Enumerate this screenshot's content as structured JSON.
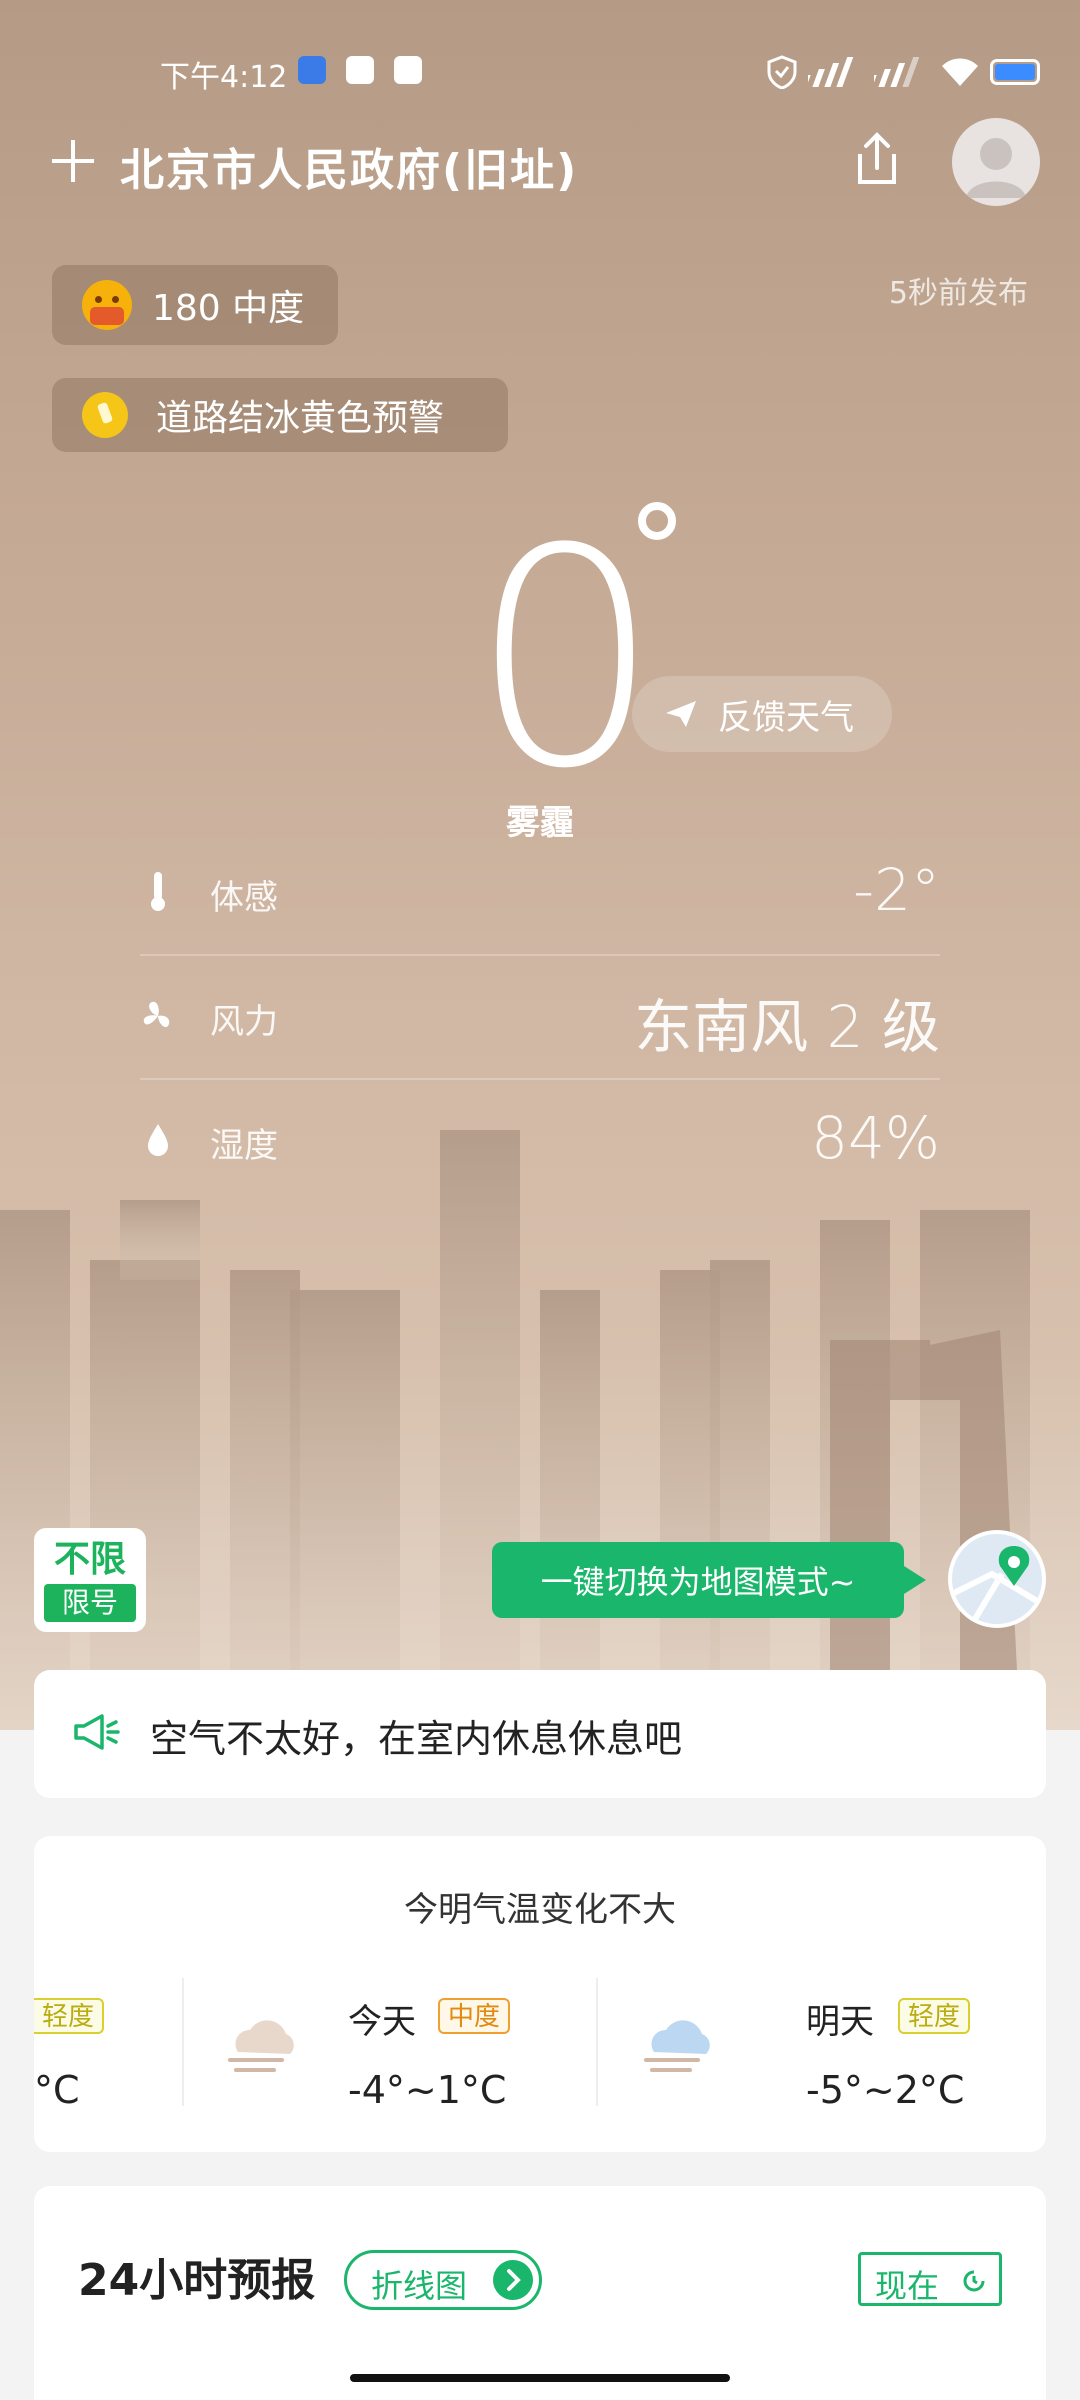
{
  "status_bar": {
    "time": "下午4:12",
    "icons": [
      "app-icon-blue",
      "app-icon-cat",
      "app-icon-clipboard"
    ],
    "right_icons": [
      "vpn-shield-icon",
      "hd-signal-icon",
      "hd-signal-icon",
      "wifi-icon",
      "battery-icon"
    ],
    "battery_color": "#3b8cff"
  },
  "header": {
    "location": "北京市人民政府(旧址)",
    "add_icon": "plus-icon",
    "share_icon": "share-icon",
    "avatar_icon": "avatar-icon"
  },
  "air_quality": {
    "value": "180 中度",
    "icon": "mask-face-icon",
    "color": "#f6b20a"
  },
  "published": "5秒前发布",
  "warning": {
    "text": "道路结冰黄色预警",
    "icon": "ice-warning-icon",
    "color": "#f5c518"
  },
  "current": {
    "temperature": "0",
    "condition": "雾霾",
    "feedback_label": "反馈天气"
  },
  "details": [
    {
      "label": "体感",
      "value": "-2°",
      "icon": "thermometer-icon"
    },
    {
      "label": "风力",
      "value": "东南风 2 级",
      "icon": "fan-icon"
    },
    {
      "label": "湿度",
      "value": "84%",
      "icon": "droplet-icon"
    }
  ],
  "traffic_limit": {
    "line1": "不限",
    "line2": "限号"
  },
  "map_mode_label": "一键切换为地图模式~",
  "tip": {
    "text": "空气不太好，在室内休息休息吧",
    "icon": "megaphone-icon"
  },
  "forecast": {
    "title": "今明气温变化不大",
    "partial": {
      "tag": "轻度",
      "range_tail": "°C"
    },
    "days": [
      {
        "name": "今天",
        "tag": "中度",
        "range": "-4°~1°C",
        "icon": "haze-cloud-icon"
      },
      {
        "name": "明天",
        "tag": "轻度",
        "range": "-5°~2°C",
        "icon": "cloud-haze-icon"
      }
    ]
  },
  "hourly": {
    "title": "24小时预报",
    "chart_toggle": "折线图",
    "now_label": "现在"
  },
  "colors": {
    "accent_green": "#19b66b",
    "tag_orange": "#e08a10",
    "tag_yellow": "#b9ad12"
  }
}
